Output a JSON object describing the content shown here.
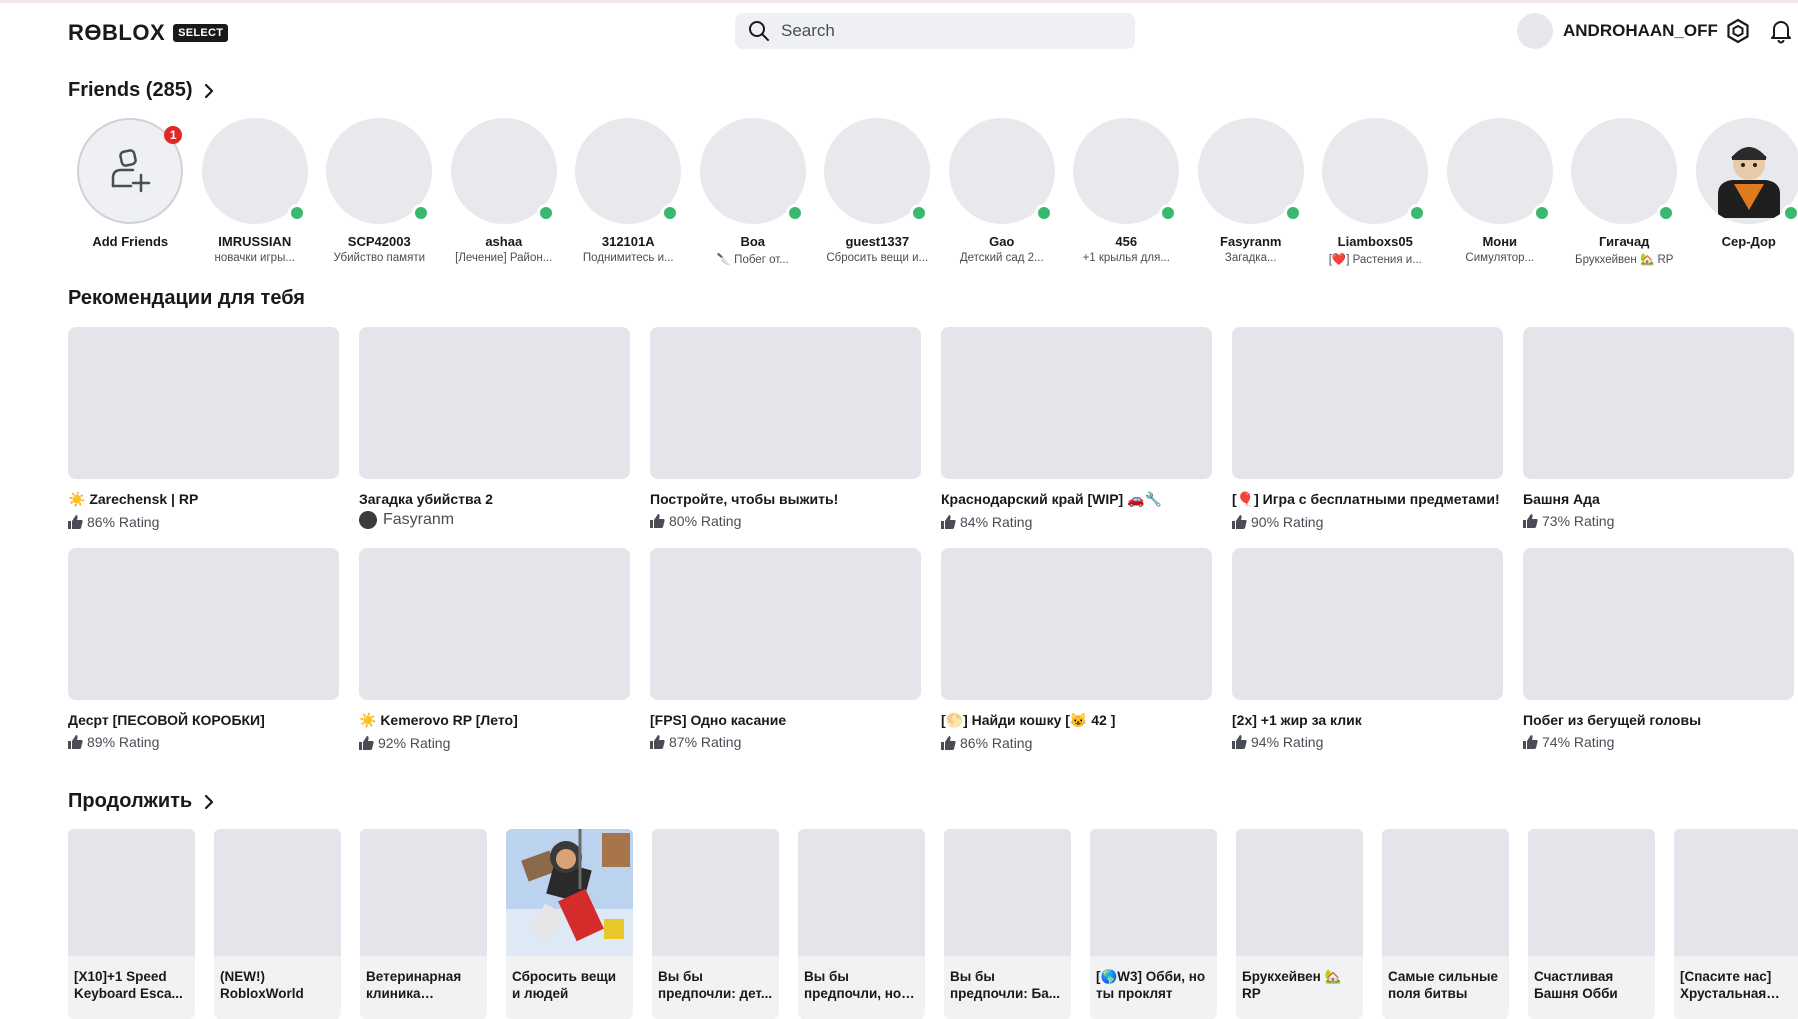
{
  "header": {
    "logo_text": "RƟBLOX",
    "logo_badge": "SELECT",
    "search_placeholder": "Search",
    "username": "ANDROHAAN_OFF"
  },
  "friends": {
    "title": "Friends (285)",
    "add_label": "Add Friends",
    "add_badge": "1",
    "items": [
      {
        "name": "IMRUSSIAN",
        "status": "новачки игры..."
      },
      {
        "name": "SCP42003",
        "status": "Убийство памяти"
      },
      {
        "name": "ashaa",
        "status": "[Лечение] Район..."
      },
      {
        "name": "312101A",
        "status": "Поднимитесь и..."
      },
      {
        "name": "Boa",
        "status": "🔪 Побег от..."
      },
      {
        "name": "guest1337",
        "status": "Сбросить вещи и..."
      },
      {
        "name": "Gao",
        "status": "Детский сад 2..."
      },
      {
        "name": "456",
        "status": "+1 крылья для..."
      },
      {
        "name": "Fasyranm",
        "status": "Загадка..."
      },
      {
        "name": "Liamboxs05",
        "status": "[❤️] Растения и..."
      },
      {
        "name": "Мони",
        "status": "Симулятор..."
      },
      {
        "name": "Гигачад",
        "status": "Брукхейвен 🏡 RP"
      },
      {
        "name": "Сер-Дор",
        "status": ""
      }
    ]
  },
  "recommended": {
    "title": "Рекомендации для тебя",
    "games": [
      {
        "name": "☀️ Zarechensk | RP",
        "rating": "86% Rating"
      },
      {
        "name": "Загадка убийства 2",
        "creator": "Fasyranm"
      },
      {
        "name": "Постройте, чтобы выжить!",
        "rating": "80% Rating"
      },
      {
        "name": "Краснодарский край [WIP] 🚗🔧",
        "rating": "84% Rating"
      },
      {
        "name": "[🎈] Игра с бесплатными предметами!",
        "rating": "90% Rating"
      },
      {
        "name": "Башня Ада",
        "rating": "73% Rating"
      },
      {
        "name": "Десрт [ПЕСОВОЙ КОРОБКИ]",
        "rating": "89% Rating"
      },
      {
        "name": "☀️ Kemerovo RP [Лето]",
        "rating": "92% Rating"
      },
      {
        "name": "[FPS] Одно касание",
        "rating": "87% Rating"
      },
      {
        "name": "[🌕] Найди кошку [😺 42 ]",
        "rating": "86% Rating"
      },
      {
        "name": "[2x] +1 жир за клик",
        "rating": "94% Rating"
      },
      {
        "name": "Побег из бегущей головы",
        "rating": "74% Rating"
      }
    ]
  },
  "continue": {
    "title": "Продолжить",
    "games": [
      {
        "name": "[X10]+1 Speed Keyboard Esca..."
      },
      {
        "name": "(NEW!) RobloxWorld"
      },
      {
        "name": "Ветеринарная клиника (Анома..."
      },
      {
        "name": "Сбросить вещи и людей"
      },
      {
        "name": "Вы бы предпочли: дет..."
      },
      {
        "name": "Вы бы предпочли, но э..."
      },
      {
        "name": "Вы бы предпочли: Ба..."
      },
      {
        "name": "[🌎W3] Обби, но ты проклят"
      },
      {
        "name": "Брукхейвен 🏡 RP"
      },
      {
        "name": "Самые сильные поля битвы"
      },
      {
        "name": "Счастливая Башня Обби"
      },
      {
        "name": "[Спасите нас] Хрустальная ба..."
      }
    ]
  },
  "colors": {
    "online": "#38b96f",
    "notification": "#e02828",
    "placeholder": "#e4e5ea"
  },
  "icons": {
    "search": "search-icon",
    "robux": "robux-icon",
    "notifications": "bell-icon",
    "add_friend": "add-friend-icon",
    "rating": "thumbs-up-icon",
    "chevron": "chevron-right-icon"
  }
}
